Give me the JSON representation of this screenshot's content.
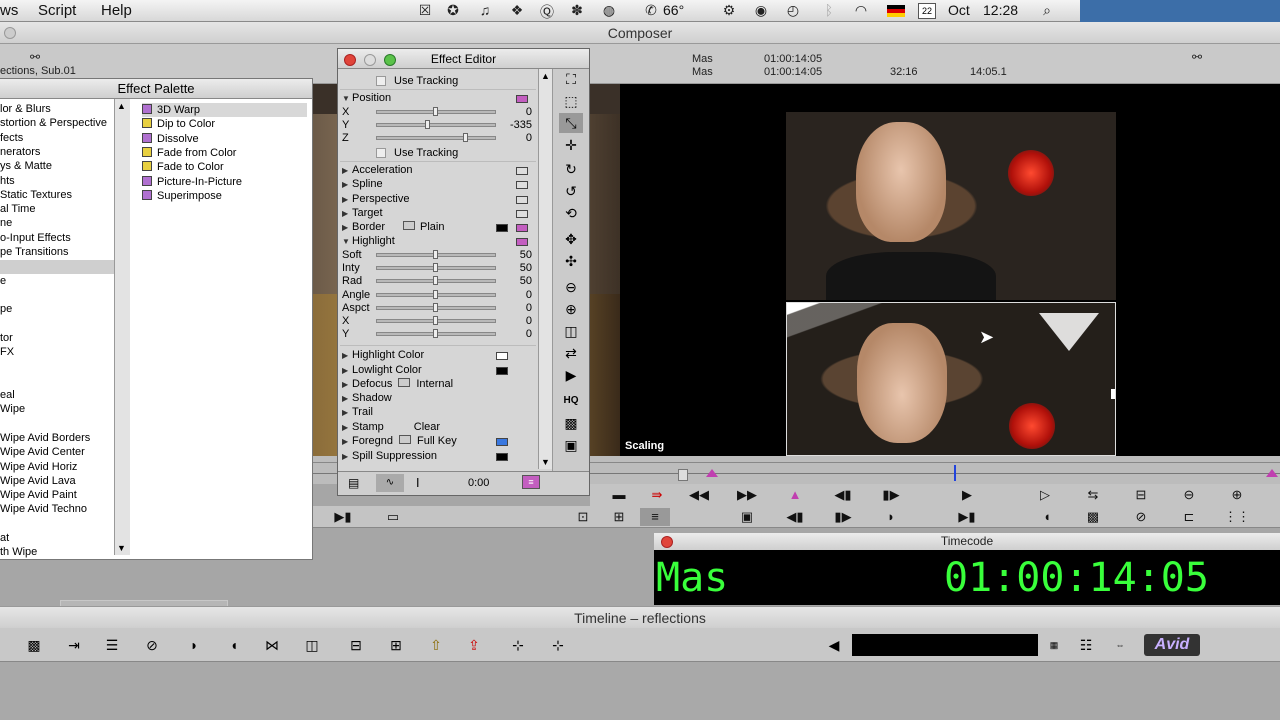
{
  "menubar": {
    "items": [
      "ws",
      "Script",
      "Help"
    ],
    "status": {
      "temperature": "66°",
      "date_label": "Oct",
      "date_icon_day": "22",
      "time": "12:28"
    }
  },
  "composer": {
    "title": "Composer",
    "sequence_name": "ections, Sub.01",
    "track1_label": "Mas",
    "track2_label": "Mas",
    "track1_tc": "01:00:14:05",
    "track2_tc": "01:00:14:05",
    "duration": "32:16",
    "frame_pos": "14:05.1",
    "video_overlay_label": "Scaling"
  },
  "effect_palette": {
    "title": "Effect Palette",
    "categories": [
      "lor & Blurs",
      "stortion & Perspective",
      "fects",
      "nerators",
      "ys & Matte",
      "hts",
      " Static Textures",
      "al Time",
      "ne",
      "o-Input Effects",
      "pe Transitions",
      "",
      "e",
      "",
      "pe",
      "",
      "tor",
      " FX",
      "",
      "",
      "eal",
      " Wipe",
      "",
      "Wipe Avid Borders",
      "Wipe Avid Center",
      "Wipe Avid Horiz",
      "Wipe Avid Lava",
      "Wipe Avid Paint",
      "Wipe Avid Techno",
      "",
      "at",
      "th Wipe"
    ],
    "effects": [
      {
        "label": "3D Warp",
        "color": "#b070d0"
      },
      {
        "label": "Dip to Color",
        "color": "#e8d040"
      },
      {
        "label": "Dissolve",
        "color": "#b070d0"
      },
      {
        "label": "Fade from Color",
        "color": "#e8d040"
      },
      {
        "label": "Fade to Color",
        "color": "#e8d040"
      },
      {
        "label": "Picture-In-Picture",
        "color": "#b070d0"
      },
      {
        "label": "Superimpose",
        "color": "#b070d0"
      }
    ]
  },
  "effect_editor": {
    "title": "Effect Editor",
    "use_tracking": "Use Tracking",
    "position": {
      "label": "Position",
      "x_label": "X",
      "y_label": "Y",
      "z_label": "Z",
      "x": "0",
      "y": "-335",
      "z": "0"
    },
    "groups": [
      "Acceleration",
      "Spline",
      "Perspective",
      "Target"
    ],
    "border": {
      "label": "Border",
      "style": "Plain"
    },
    "highlight": {
      "label": "Highlight",
      "params": [
        {
          "name": "Soft",
          "value": "50"
        },
        {
          "name": "Inty",
          "value": "50"
        },
        {
          "name": "Rad",
          "value": "50"
        },
        {
          "name": "Angle",
          "value": "0"
        },
        {
          "name": "Aspct",
          "value": "0"
        },
        {
          "name": "X",
          "value": "0"
        },
        {
          "name": "Y",
          "value": "0"
        }
      ]
    },
    "highlight_color": "Highlight Color",
    "lowlight_color": "Lowlight Color",
    "defocus": {
      "label": "Defocus",
      "mode": "Internal"
    },
    "shadow": "Shadow",
    "trail": "Trail",
    "stamp": {
      "label": "Stamp",
      "clear": "Clear"
    },
    "foregnd": {
      "label": "Foregnd",
      "mode": "Full Key"
    },
    "spill": "Spill Suppression",
    "bottom_time": "0:00",
    "tool_hq": "HQ"
  },
  "timecode_window": {
    "title": "Timecode",
    "track": "Mas",
    "timecode": "01:00:14:05"
  },
  "timeline": {
    "title": "Timeline – reflections",
    "logo": "Avid"
  },
  "colors": {
    "timecode_green": "#39ff3b",
    "menubar_blue": "#3c6ea8"
  }
}
